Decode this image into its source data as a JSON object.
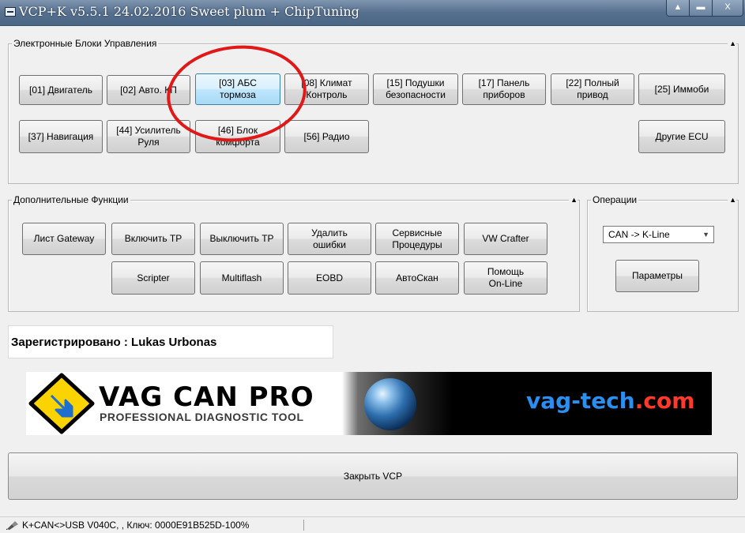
{
  "window": {
    "title": "VCP+K v5.5.1 24.02.2016 Sweet plum + ChipTuning",
    "minimize_glyph": "▲",
    "maximize_glyph": "▬",
    "close_glyph": "X"
  },
  "ecu_group": {
    "title": "Электронные Блоки Управления",
    "collapse_glyph": "▲",
    "buttons": [
      "[01] Двигатель",
      "[02] Авто. КП",
      "[03] АБС\nтормоза",
      "[08] Климат\nКонтроль",
      "[15] Подушки\nбезопасности",
      "[17] Панель\nприборов",
      "[22] Полный\nпривод",
      "[25] Иммоби",
      "[37] Навигация",
      "[44] Усилитель\nРуля",
      "[46] Блок\nкомфорта",
      "[56] Радио",
      "Другие ECU"
    ]
  },
  "extra_group": {
    "title": "Дополнительные Функции",
    "collapse_glyph": "▲",
    "buttons": [
      "Лист Gateway",
      "Включить ТР",
      "Выключить ТР",
      "Удалить\nошибки",
      "Сервисные\nПроцедуры",
      "VW Crafter",
      "Scripter",
      "Multiflash",
      "EOBD",
      "АвтоСкан",
      "Помощь\nOn-Line"
    ]
  },
  "operations_group": {
    "title": "Операции",
    "collapse_glyph": "▲",
    "protocol_select": {
      "value": "CAN -> K-Line"
    },
    "params_button": "Параметры"
  },
  "registration": {
    "text": "Зарегистрировано : Lukas Urbonas"
  },
  "banner": {
    "brand": "VAG CAN PRO",
    "tagline": "PROFESSIONAL DIAGNOSTIC TOOL",
    "url_name": "vag-tech",
    "url_tld": ".com"
  },
  "close_button": "Закрыть VCP",
  "status_bar": {
    "text": "K+CAN<>USB V040C, , Ключ: 0000E91B525D-100%"
  },
  "colors": {
    "titlebar": "#56708f",
    "selected_button": "#bee6fd",
    "annotation_circle": "#e01818",
    "url_blue": "#2a8ff0",
    "url_red": "#ff3a2a"
  }
}
